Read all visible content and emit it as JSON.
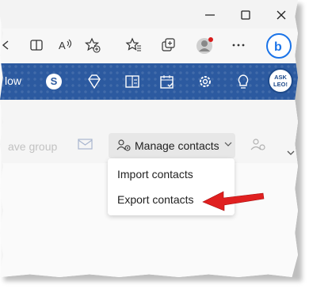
{
  "window": {
    "minimize_icon": "minimize-icon",
    "maximize_icon": "maximize-icon",
    "close_icon": "close-icon"
  },
  "browser_toolbar": {
    "icons": [
      "split-screen-icon",
      "read-aloud-icon",
      "favorite-add-icon",
      "favorites-icon",
      "collections-icon",
      "profile-icon",
      "bing-icon"
    ]
  },
  "banner": {
    "partial_text": "low",
    "accent_color": "#2c5aa0",
    "icons": [
      "skype-icon",
      "diamond-icon",
      "office-icon",
      "calendar-check-icon",
      "settings-icon",
      "lightbulb-icon"
    ],
    "logo_text": "ASK LEO!"
  },
  "command_bar": {
    "ghost_label": "ave group",
    "manage_contacts_label": "Manage contacts"
  },
  "menu": {
    "items": [
      {
        "label": "Import contacts"
      },
      {
        "label": "Export contacts"
      }
    ]
  },
  "annotation": {
    "arrow_color": "#e02020"
  }
}
